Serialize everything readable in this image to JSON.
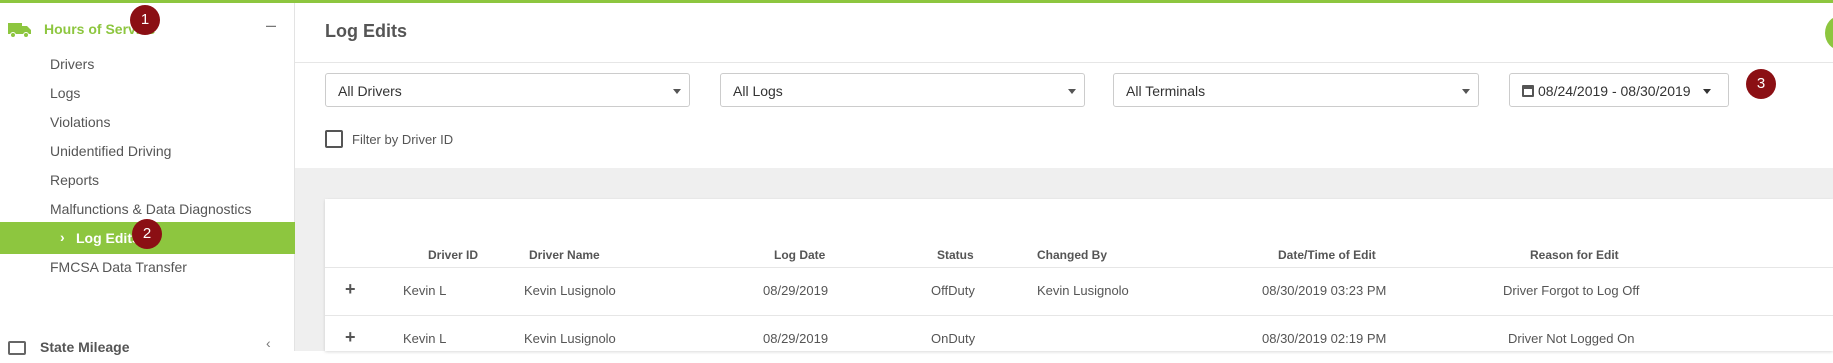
{
  "colors": {
    "accent": "#8dc63f",
    "badge": "#8b0f14"
  },
  "sidebar": {
    "section_title": "Hours of Service",
    "section_icon": "truck-icon",
    "collapse_symbol": "–",
    "items": [
      {
        "label": "Drivers"
      },
      {
        "label": "Logs"
      },
      {
        "label": "Violations"
      },
      {
        "label": "Unidentified Driving"
      },
      {
        "label": "Reports"
      },
      {
        "label": "Malfunctions & Data Diagnostics"
      },
      {
        "label": "Log Edits",
        "active": true
      },
      {
        "label": "FMCSA Data Transfer"
      }
    ],
    "next_section": "State Mileage"
  },
  "badges": {
    "one": "1",
    "two": "2",
    "three": "3"
  },
  "header": {
    "title": "Log Edits"
  },
  "filters": {
    "drivers": "All Drivers",
    "logs": "All Logs",
    "terminals": "All Terminals",
    "date_range": "08/24/2019 - 08/30/2019",
    "filter_by_driver_id": "Filter by Driver ID"
  },
  "table": {
    "columns": [
      "Driver ID",
      "Driver Name",
      "Log Date",
      "Status",
      "Changed By",
      "Date/Time of Edit",
      "Reason for Edit"
    ],
    "rows": [
      {
        "expand": "+",
        "driver_id": "Kevin L",
        "driver_name": "Kevin Lusignolo",
        "log_date": "08/29/2019",
        "status": "OffDuty",
        "changed_by": "Kevin Lusignolo",
        "edit_time": "08/30/2019 03:23 PM",
        "reason": "Driver Forgot to Log Off"
      },
      {
        "expand": "+",
        "driver_id": "Kevin L",
        "driver_name": "Kevin Lusignolo",
        "log_date": "08/29/2019",
        "status": "OnDuty",
        "changed_by": "",
        "edit_time": "08/30/2019 02:19 PM",
        "reason": "Driver Not Logged On"
      }
    ]
  }
}
